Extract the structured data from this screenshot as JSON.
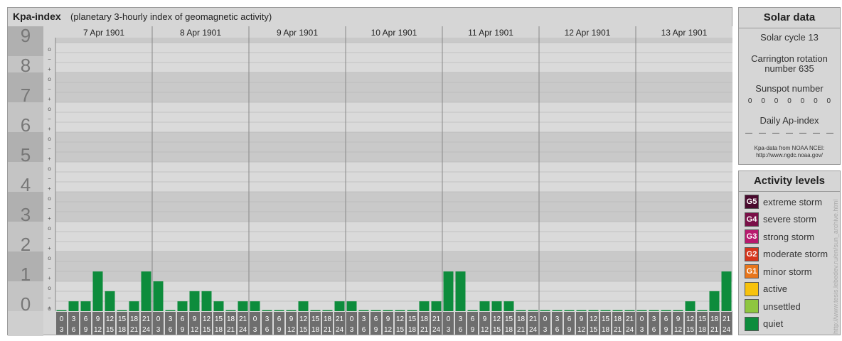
{
  "header": {
    "title": "Kpa-index",
    "subtitle": "(planetary 3-hourly index of geomagnetic activity)"
  },
  "chart_data": {
    "type": "bar",
    "days": [
      "7 Apr 1901",
      "8 Apr 1901",
      "9 Apr 1901",
      "10 Apr 1901",
      "11 Apr 1901",
      "12 Apr 1901",
      "13 Apr 1901"
    ],
    "intervals": [
      [
        "0",
        "3"
      ],
      [
        "3",
        "6"
      ],
      [
        "6",
        "9"
      ],
      [
        "9",
        "12"
      ],
      [
        "12",
        "15"
      ],
      [
        "15",
        "18"
      ],
      [
        "18",
        "21"
      ],
      [
        "21",
        "24"
      ]
    ],
    "y_ticks": [
      "0",
      "1",
      "2",
      "3",
      "4",
      "5",
      "6",
      "7",
      "8",
      "9"
    ],
    "minor_ticks": [
      "+",
      "o",
      "−"
    ],
    "ylim": [
      0,
      9.33
    ],
    "values": [
      [
        0,
        0.33,
        0.33,
        1.33,
        0.67,
        0,
        0.33,
        1.33
      ],
      [
        1,
        0,
        0.33,
        0.67,
        0.67,
        0.33,
        0,
        0.33
      ],
      [
        0.33,
        0,
        0,
        0,
        0.33,
        0,
        0,
        0.33
      ],
      [
        0.33,
        0,
        0,
        0,
        0,
        0,
        0.33,
        0.33
      ],
      [
        1.33,
        1.33,
        0,
        0.33,
        0.33,
        0.33,
        0,
        0
      ],
      [
        0,
        0,
        0,
        0,
        0,
        0,
        0,
        0
      ],
      [
        0,
        0,
        0,
        0,
        0.33,
        0,
        0.67,
        1.33
      ]
    ],
    "bar_color": "#0d8c3c"
  },
  "solar": {
    "title": "Solar data",
    "cycle": "Solar cycle 13",
    "carrington_line1": "Carrington rotation",
    "carrington_line2": "number 635",
    "sunspot_label": "Sunspot number",
    "sunspot_values": [
      "0",
      "0",
      "0",
      "0",
      "0",
      "0",
      "0"
    ],
    "ap_label": "Daily Ap-index",
    "ap_values": [
      "—",
      "—",
      "—",
      "—",
      "—",
      "—",
      "—"
    ],
    "source_line1": "Kpa-data from NOAA NCEI:",
    "source_line2": "http://www.ngdc.noaa.gov/"
  },
  "activity": {
    "title": "Activity levels",
    "levels": [
      {
        "badge": "G5",
        "label": "extreme storm",
        "color": "#4a0a2e"
      },
      {
        "badge": "G4",
        "label": "severe storm",
        "color": "#7a1048"
      },
      {
        "badge": "G3",
        "label": "strong storm",
        "color": "#b8196e"
      },
      {
        "badge": "G2",
        "label": "moderate storm",
        "color": "#d5351c"
      },
      {
        "badge": "G1",
        "label": "minor storm",
        "color": "#e8761c"
      },
      {
        "badge": "",
        "label": "active",
        "color": "#f7c20c"
      },
      {
        "badge": "",
        "label": "unsettled",
        "color": "#8ec63f"
      },
      {
        "badge": "",
        "label": "quiet",
        "color": "#0d8c3c"
      }
    ]
  },
  "watermark": "http://www.tesis.lebedev.ru/en/sun_archive.html"
}
